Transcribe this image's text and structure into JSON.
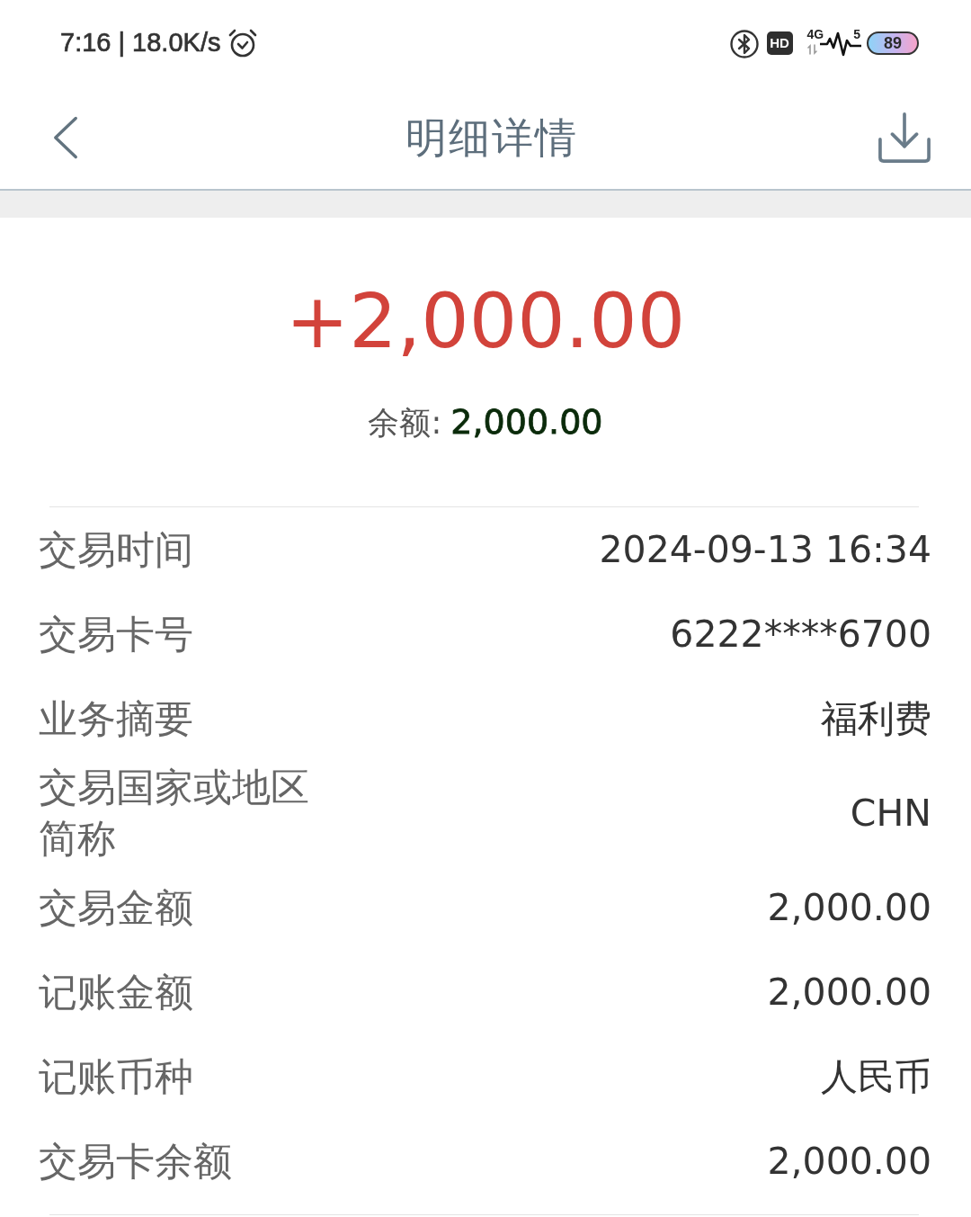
{
  "status_bar": {
    "time_and_speed": "7:16 | 18.0K/s",
    "hd": "HD",
    "network_type": "4G",
    "signal_label": "5",
    "battery": "89"
  },
  "header": {
    "title": "明细详情"
  },
  "amount": "+2,000.00",
  "balance": {
    "label": "余额:",
    "value": "2,000.00"
  },
  "details": [
    {
      "label": "交易时间",
      "value": "2024-09-13 16:34"
    },
    {
      "label": "交易卡号",
      "value": "6222****6700"
    },
    {
      "label": "业务摘要",
      "value": "福利费"
    },
    {
      "label": "交易国家或地区简称",
      "value": "CHN"
    },
    {
      "label": "交易金额",
      "value": "2,000.00"
    },
    {
      "label": "记账金额",
      "value": "2,000.00"
    },
    {
      "label": "记账币种",
      "value": "人民币"
    },
    {
      "label": "交易卡余额",
      "value": "2,000.00"
    }
  ]
}
